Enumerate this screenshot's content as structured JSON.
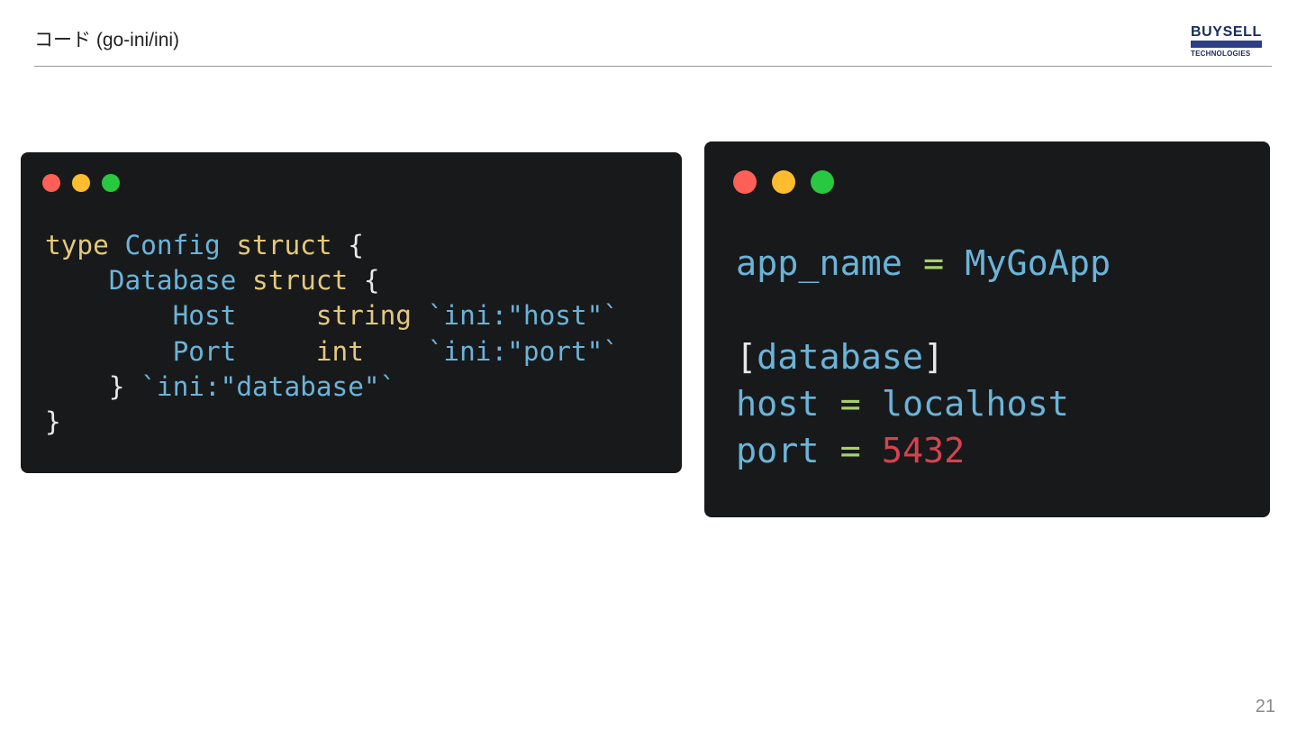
{
  "slide": {
    "title": "コード (go-ini/ini)",
    "page_number": "21"
  },
  "logo": {
    "top_text": "BUYSELL",
    "bottom_text": "TECHNOLOGIES",
    "color": "#1a2a5e"
  },
  "colors": {
    "code_background": "#18191b",
    "keyword": "#e3c97a",
    "identifier": "#6ab4d9",
    "operator": "#a9cf6d",
    "number": "#d4434e",
    "window_red": "#fe5f57",
    "window_yellow": "#febc2e",
    "window_green": "#28c840"
  },
  "go_code": {
    "l1_type": "type",
    "l1_name": "Config",
    "l1_struct": "struct",
    "l1_brace": "{",
    "l2_name": "Database",
    "l2_struct": "struct",
    "l2_brace": "{",
    "l3_field": "Host",
    "l3_type": "string",
    "l3_tag": "`ini:\"host\"`",
    "l4_field": "Port",
    "l4_type": "int",
    "l4_tag": "`ini:\"port\"`",
    "l5_brace": "}",
    "l5_tag": "`ini:\"database\"`",
    "l6_brace": "}"
  },
  "ini_code": {
    "l1_key": "app_name",
    "l1_eq": "=",
    "l1_value": "MyGoApp",
    "section_open": "[",
    "section_name": "database",
    "section_close": "]",
    "l2_key": "host",
    "l2_eq": "=",
    "l2_value": "localhost",
    "l3_key": "port",
    "l3_eq": "=",
    "l3_value": "5432"
  }
}
